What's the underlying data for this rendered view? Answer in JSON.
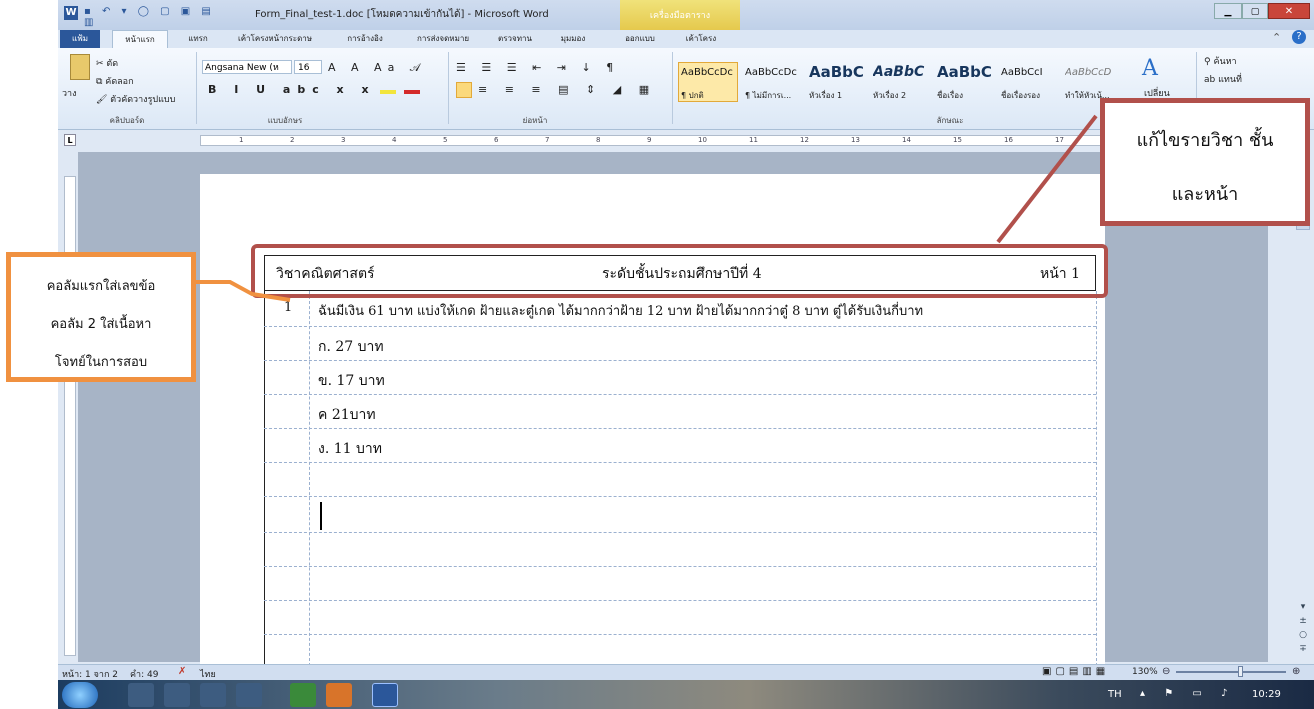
{
  "window": {
    "title": "Form_Final_test-1.doc [โหมดความเข้ากันได้] - Microsoft Word",
    "context_tab": "เครื่องมือตาราง"
  },
  "tabs": [
    "แฟ้ม",
    "หน้าแรก",
    "แทรก",
    "เค้าโครงหน้ากระดาษ",
    "การอ้างอิง",
    "การส่งจดหมาย",
    "ตรวจทาน",
    "มุมมอง",
    "ออกแบบ",
    "เค้าโครง"
  ],
  "ribbon": {
    "clipboard": {
      "cut": "ตัด",
      "copy": "คัดลอก",
      "paste": "วาง",
      "format_painter": "ตัวคัดวางรูปแบบ",
      "label": "คลิปบอร์ด"
    },
    "font": {
      "name": "Angsana New (ห",
      "size": "16",
      "label": "แบบอักษร"
    },
    "paragraph": {
      "label": "ย่อหน้า"
    },
    "styles": {
      "label": "ลักษณะ",
      "items": [
        {
          "preview": "AaBbCcDc",
          "name": "¶ ปกติ"
        },
        {
          "preview": "AaBbCcDc",
          "name": "¶ ไม่มีการเ..."
        },
        {
          "preview": "AaBbC",
          "name": "หัวเรื่อง 1"
        },
        {
          "preview": "AaBbC",
          "name": "หัวเรื่อง 2"
        },
        {
          "preview": "AaBbC",
          "name": "ชื่อเรื่อง"
        },
        {
          "preview": "AaBbCcI",
          "name": "ชื่อเรื่องรอง"
        },
        {
          "preview": "AaBbCcD",
          "name": "ทำให้หัวเน้..."
        }
      ],
      "change_styles": "เปลี่ยน"
    },
    "editing": {
      "find": "ค้นหา",
      "replace": "แทนที่"
    }
  },
  "ruler_numbers": [
    "1",
    "2",
    "3",
    "4",
    "5",
    "6",
    "7",
    "8",
    "9",
    "10",
    "11",
    "12",
    "13",
    "14",
    "15",
    "16",
    "17"
  ],
  "document": {
    "header": {
      "subject": "วิชาคณิตศาสตร์",
      "level": "ระดับชั้นประถมศึกษาปีที่ 4",
      "page": "หน้า 1"
    },
    "question_number": "1",
    "question": "ฉันมีเงิน 61 บาท แบ่งให้เกด ฝ้ายและตู๋เกด ได้มากกว่าฝ้าย 12 บาท ฝ้ายได้มากกว่าตู๋ 8 บาท ตู๋ได้รับเงินกี่บาท",
    "choices": [
      "ก. 27 บาท",
      "ข. 17 บาท",
      "ค 21บาท",
      "ง. 11 บาท"
    ]
  },
  "callouts": {
    "edit_header": {
      "line1": "แก้ไขรายวิชา ชั้น",
      "line2": "และหน้า"
    },
    "columns": {
      "line1": "คอลัมแรกใส่เลขข้อ",
      "line2": "คอลัม 2 ใส่เนื้อหา",
      "line3": "โจทย์ในการสอบ"
    }
  },
  "status": {
    "page": "หน้า: 1 จาก 2",
    "words": "คำ: 49",
    "language": "ไทย",
    "zoom": "130%"
  },
  "taskbar": {
    "lang": "TH",
    "time": "10:29"
  },
  "colors": {
    "callout_red": "#b1504b",
    "callout_orange": "#f09140"
  }
}
